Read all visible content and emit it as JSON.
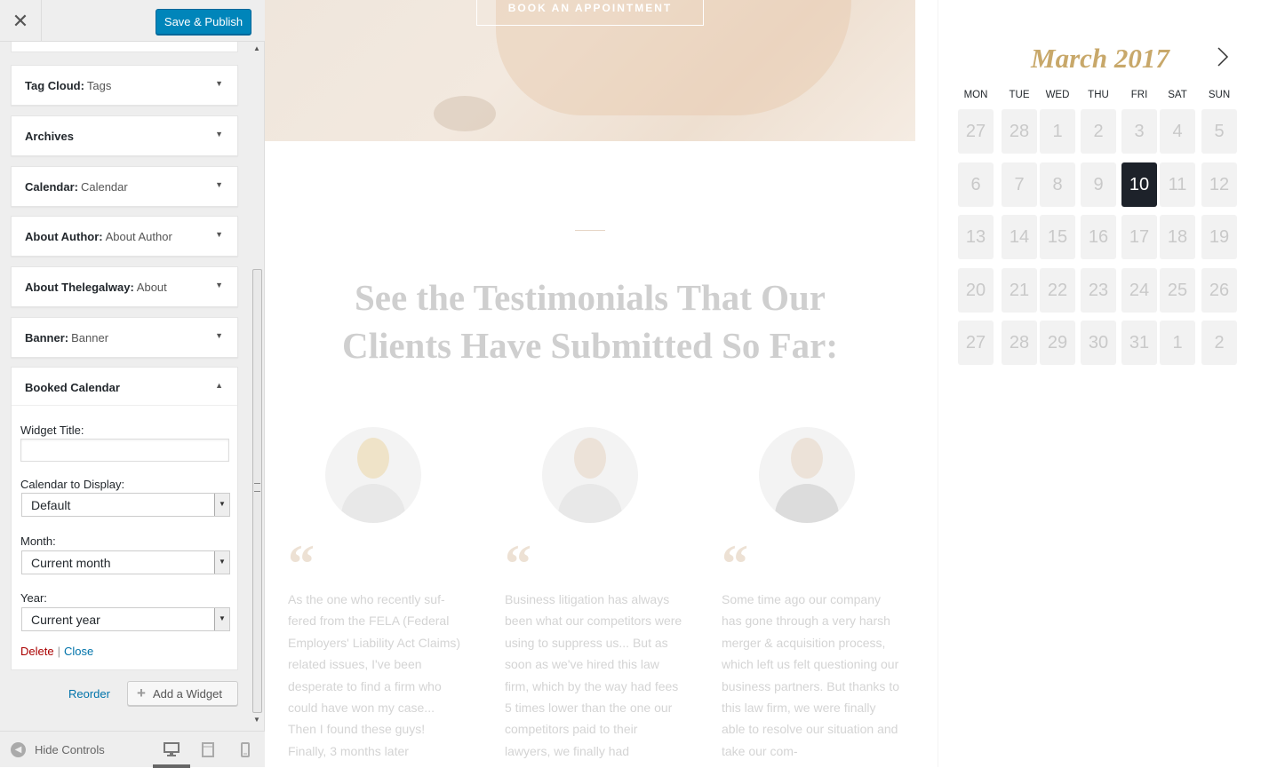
{
  "header": {
    "close_icon": "close-icon",
    "save_label": "Save & Publish",
    "save_color": "#0085ba"
  },
  "widgets": [
    {
      "name": "Tag Cloud:",
      "sub": "Tags"
    },
    {
      "name": "Archives",
      "sub": ""
    },
    {
      "name": "Calendar:",
      "sub": "Calendar"
    },
    {
      "name": "About Author:",
      "sub": "About Author"
    },
    {
      "name": "About Thelegalway:",
      "sub": "About"
    },
    {
      "name": "Banner:",
      "sub": "Banner"
    }
  ],
  "booked": {
    "title": "Booked Calendar",
    "widget_title_label": "Widget Title:",
    "widget_title_value": "",
    "calendar_label": "Calendar to Display:",
    "calendar_value": "Default",
    "month_label": "Month:",
    "month_value": "Current month",
    "year_label": "Year:",
    "year_value": "Current year",
    "delete_label": "Delete",
    "separator": "|",
    "close_label": "Close"
  },
  "panel_actions": {
    "reorder_label": "Reorder",
    "add_widget_label": "Add a Widget"
  },
  "footer": {
    "hide_controls_label": "Hide Controls",
    "devices": [
      "desktop-icon",
      "tablet-icon",
      "mobile-icon"
    ],
    "active_device": "desktop"
  },
  "preview": {
    "hero_button": "BOOK AN APPOINTMENT",
    "heading": "See the Testimonials That Our Clients Have Submitted So Far:",
    "quote_mark": "“",
    "testimonials": [
      {
        "text": "As the one who recently suf-fered from the FELA (Federal Employers' Liability Act Claims) related issues, I've been desperate to find a firm who could have won my case... Then I found these guys! Finally, 3 months later"
      },
      {
        "text": "Business litigation has always been what our competitors were using to suppress us... But as soon as we've hired this law firm, which by the way had fees 5 times lower than the one our competitors paid to their lawyers, we finally had"
      },
      {
        "text": "Some time ago our company has gone through a very harsh merger & acquisition process, which left us felt questioning our business partners. But thanks to this law firm, we were finally able to resolve our situation and take our com-"
      }
    ]
  },
  "calendar": {
    "month_title": "March 2017",
    "next_icon": "chevron-right-icon",
    "accent_color": "#c8a86a",
    "day_headers": [
      "MON",
      "TUE",
      "WED",
      "THU",
      "FRI",
      "SAT",
      "SUN"
    ],
    "weeks": [
      [
        "27",
        "28",
        "1",
        "2",
        "3",
        "4",
        "5"
      ],
      [
        "6",
        "7",
        "8",
        "9",
        "10",
        "11",
        "12"
      ],
      [
        "13",
        "14",
        "15",
        "16",
        "17",
        "18",
        "19"
      ],
      [
        "20",
        "21",
        "22",
        "23",
        "24",
        "25",
        "26"
      ],
      [
        "27",
        "28",
        "29",
        "30",
        "31",
        "1",
        "2"
      ]
    ],
    "selected_day": "10"
  }
}
